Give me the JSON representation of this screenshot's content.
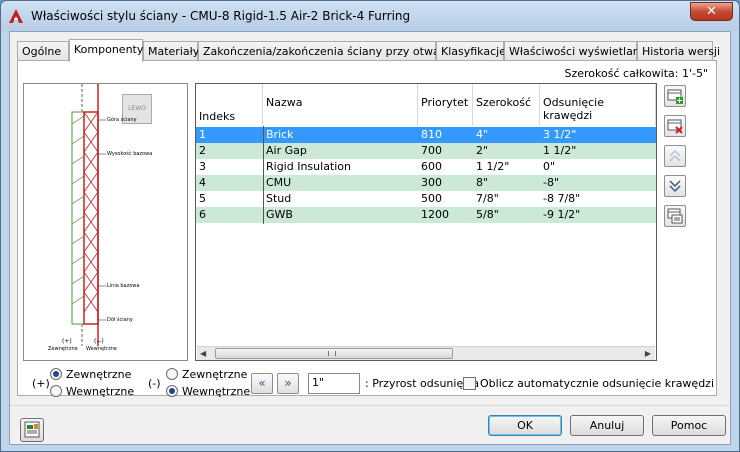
{
  "window": {
    "title": "Właściwości stylu ściany - CMU-8 Rigid-1.5 Air-2 Brick-4 Furring",
    "close_label": "✕"
  },
  "tabs": [
    {
      "label": "Ogólne"
    },
    {
      "label": "Komponenty"
    },
    {
      "label": "Materiały"
    },
    {
      "label": "Zakończenia/zakończenia ściany przy otwarciu"
    },
    {
      "label": "Klasyfikacje"
    },
    {
      "label": "Właściwości wyświetlania"
    },
    {
      "label": "Historia wersji"
    }
  ],
  "active_tab": "Komponenty",
  "total_width": "Szerokość całkowita: 1'-5\"",
  "preview": {
    "view_badge": "LEWO",
    "labels": {
      "top": "Góra ściany",
      "base_height": "Wysokość bazowa",
      "baseline": "Linia bazowa",
      "bottom": "Dół ściany",
      "exterior_sign": "(+)",
      "interior_sign": "(−)",
      "exterior": "Zewnętrzne",
      "interior": "Wewnętrzne"
    }
  },
  "table": {
    "headers": [
      "Indeks",
      "Nazwa",
      "Priorytet",
      "Szerokość",
      "Odsunięcie krawędzi"
    ],
    "rows": [
      {
        "index": "1",
        "name": "Brick",
        "priority": "810",
        "width": "4\"",
        "offset": "3 1/2\""
      },
      {
        "index": "2",
        "name": "Air Gap",
        "priority": "700",
        "width": "2\"",
        "offset": "1 1/2\""
      },
      {
        "index": "3",
        "name": "Rigid Insulation",
        "priority": "600",
        "width": "1 1/2\"",
        "offset": "0\""
      },
      {
        "index": "4",
        "name": "CMU",
        "priority": "300",
        "width": "8\"",
        "offset": "-8\""
      },
      {
        "index": "5",
        "name": "Stud",
        "priority": "500",
        "width": "7/8\"",
        "offset": "-8 7/8\""
      },
      {
        "index": "6",
        "name": "GWB",
        "priority": "1200",
        "width": "5/8\"",
        "offset": "-9 1/2\""
      }
    ],
    "selected_row": 1
  },
  "side_buttons": [
    {
      "icon": "add-component-icon"
    },
    {
      "icon": "delete-component-icon"
    },
    {
      "icon": "move-up-icon"
    },
    {
      "icon": "move-down-icon"
    },
    {
      "icon": "component-list-icon"
    }
  ],
  "options": {
    "plus_sign": "(+)",
    "minus_sign": "(-)",
    "exterior": "Zewnętrzne",
    "interior": "Wewnętrzne",
    "plus_selected": "Zewnętrzne",
    "minus_selected": "Wewnętrzne",
    "offset_increment_value": "1\"",
    "offset_increment_label": ": Przyrost odsunięcia",
    "auto_offset_label": "Oblicz automatycznie odsunięcie krawędzi",
    "auto_offset_checked": false
  },
  "buttons": {
    "ok": "OK",
    "cancel": "Anuluj",
    "help": "Pomoc"
  },
  "colors": {
    "selected_row": "#3399ff",
    "alt_row": "#cce8d6",
    "accent": "#1b4b8a"
  }
}
